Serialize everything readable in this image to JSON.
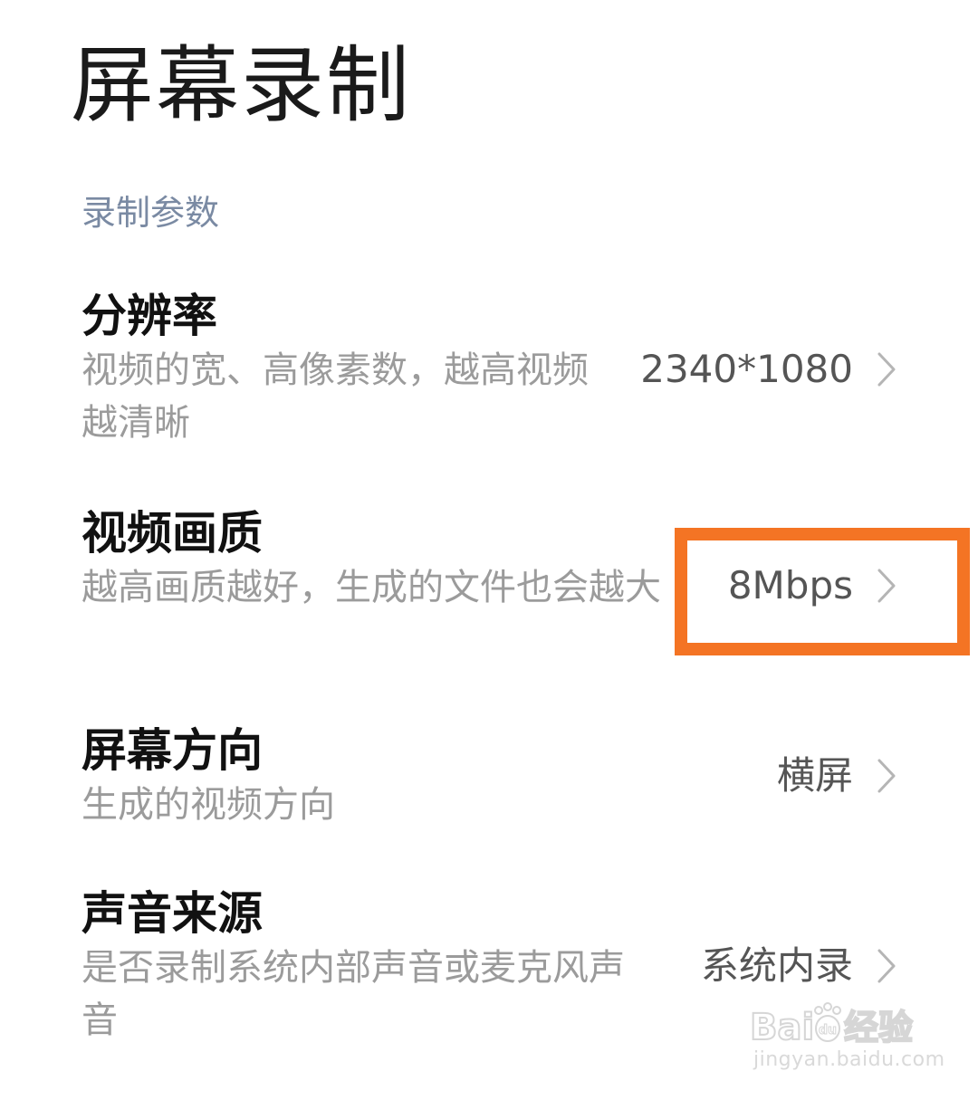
{
  "page": {
    "title": "屏幕录制"
  },
  "section": {
    "header": "录制参数"
  },
  "settings": [
    {
      "title": "分辨率",
      "description": "视频的宽、高像素数，越高视频越清晰",
      "value": "2340*1080"
    },
    {
      "title": "视频画质",
      "description": "越高画质越好，生成的文件也会越大",
      "value": "8Mbps"
    },
    {
      "title": "屏幕方向",
      "description": "生成的视频方向",
      "value": "横屏"
    },
    {
      "title": "声音来源",
      "description": "是否录制系统内部声音或麦克风声音",
      "value": "系统内录"
    }
  ],
  "annotation": {
    "highlight_color": "#f47424"
  },
  "watermark": {
    "logo": "Baidu经验",
    "url": "jingyan.baidu.com"
  },
  "icons": {
    "chevron": "chevron-right-icon"
  }
}
